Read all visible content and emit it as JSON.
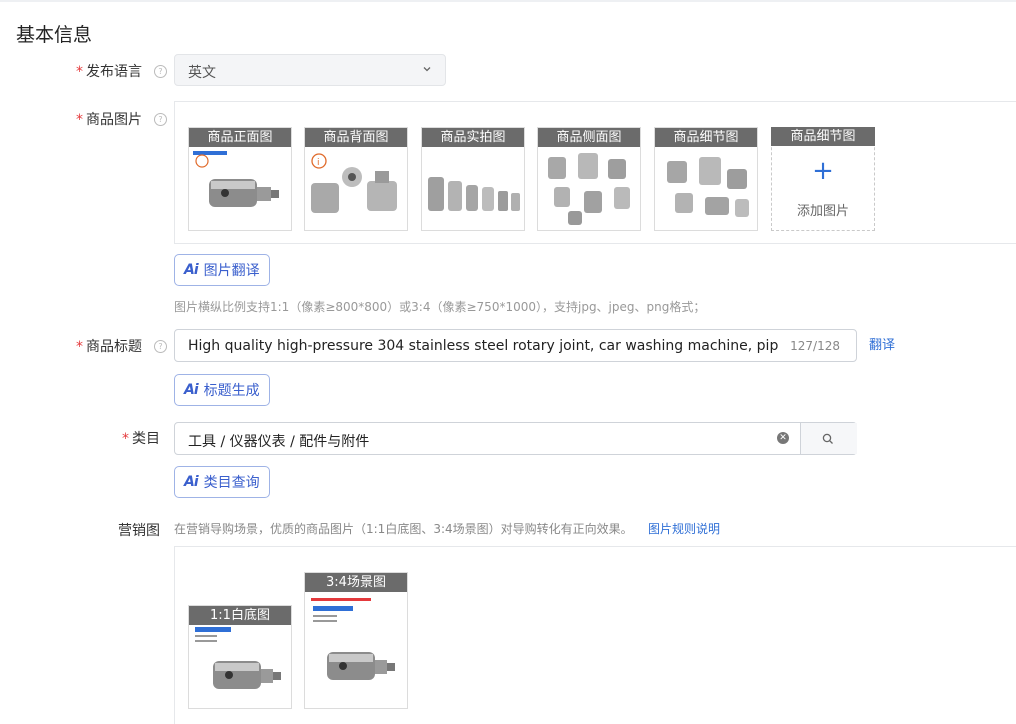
{
  "section_title": "基本信息",
  "language": {
    "label": "发布语言",
    "value": "英文"
  },
  "product_images": {
    "label": "商品图片",
    "items": [
      {
        "caption": "商品正面图"
      },
      {
        "caption": "商品背面图"
      },
      {
        "caption": "商品实拍图"
      },
      {
        "caption": "商品侧面图"
      },
      {
        "caption": "商品细节图"
      }
    ],
    "add_caption": "商品细节图",
    "add_text": "添加图片",
    "translate_btn": "图片翻译",
    "hint": "图片横纵比例支持1:1（像素≥800*800）或3:4（像素≥750*1000），支持jpg、jpeg、png格式；"
  },
  "title_field": {
    "label": "商品标题",
    "value": "High quality high-pressure 304 stainless steel rotary joint, car washing machine, pipe roller,",
    "count": "127/128",
    "translate_link": "翻译",
    "generate_btn": "标题生成"
  },
  "category": {
    "label": "类目",
    "value": "工具 / 仪器仪表 / 配件与附件",
    "query_btn": "类目查询"
  },
  "marketing": {
    "label": "营销图",
    "hint": "在营销导购场景，优质的商品图片（1:1白底图、3:4场景图）对导购转化有正向效果。",
    "rule_link": "图片规则说明",
    "items": [
      {
        "caption": "1:1白底图"
      },
      {
        "caption": "3:4场景图"
      }
    ]
  },
  "colors": {
    "accent": "#2f6fd6",
    "required_star": "#e4393c",
    "caption_bg": "#6b6b6b"
  }
}
